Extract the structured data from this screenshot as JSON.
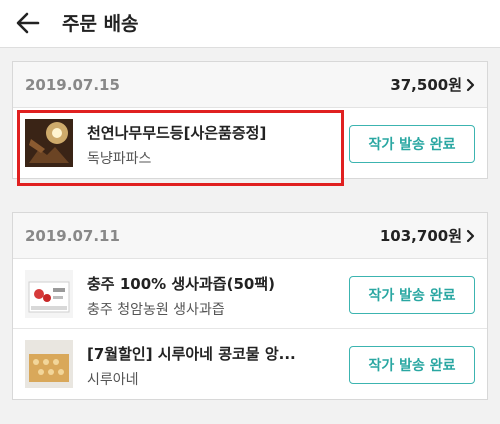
{
  "header": {
    "title": "주문 배송"
  },
  "orders": [
    {
      "date": "2019.07.15",
      "total": "37,500원",
      "items": [
        {
          "name": "천연나무무드등[사은품증정]",
          "seller": "독냥파파스",
          "status": "작가 발송 완료"
        }
      ]
    },
    {
      "date": "2019.07.11",
      "total": "103,700원",
      "items": [
        {
          "name": "충주 100% 생사과즙(50팩)",
          "seller": "충주 청암농원 생사과즙",
          "status": "작가 발송 완료"
        },
        {
          "name": "[7월할인] 시루아네 콩코물 앙...",
          "seller": "시루아네",
          "status": "작가 발송 완료"
        }
      ]
    }
  ],
  "colors": {
    "accent": "#2aa7a2",
    "highlight": "#e02020"
  },
  "icons": {
    "back": "arrow-left-icon",
    "chevron": "chevron-right-icon"
  }
}
